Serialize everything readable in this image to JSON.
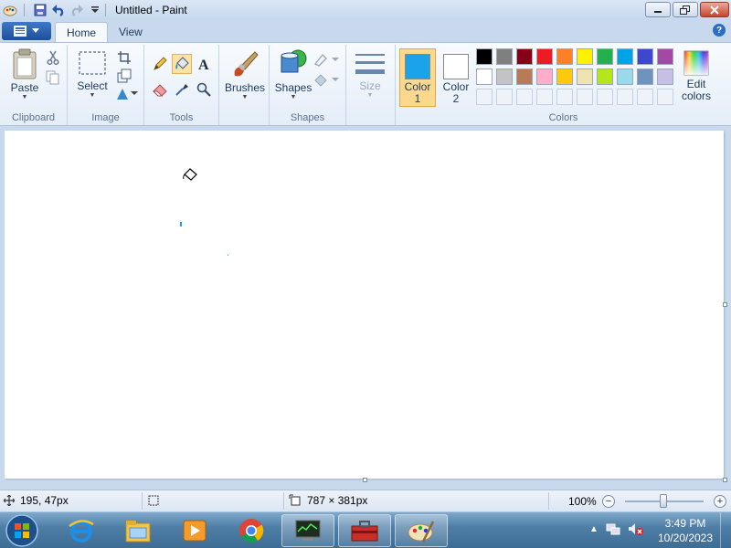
{
  "window": {
    "title": "Untitled - Paint"
  },
  "tabs": {
    "home": "Home",
    "view": "View"
  },
  "ribbon": {
    "clipboard": {
      "group_label": "Clipboard",
      "paste_label": "Paste"
    },
    "image": {
      "group_label": "Image",
      "select_label": "Select"
    },
    "tools": {
      "group_label": "Tools"
    },
    "brushes": {
      "label": "Brushes"
    },
    "shapes": {
      "group_label": "Shapes",
      "shapes_label": "Shapes"
    },
    "size": {
      "label": "Size"
    },
    "colors": {
      "group_label": "Colors",
      "color1_label": "Color 1",
      "color2_label": "Color 2",
      "color1_value": "#1aa3e8",
      "color2_value": "#ffffff",
      "edit_label": "Edit colors",
      "palette_row1": [
        "#000000",
        "#7f7f7f",
        "#880015",
        "#ed1c24",
        "#ff7f27",
        "#fff200",
        "#22b14c",
        "#00a2e8",
        "#3f48cc",
        "#a349a4"
      ],
      "palette_row2": [
        "#ffffff",
        "#c3c3c3",
        "#b97a57",
        "#ffaec9",
        "#ffc90e",
        "#efe4b0",
        "#b5e61d",
        "#99d9ea",
        "#7092be",
        "#c8bfe7"
      ]
    }
  },
  "canvas": {
    "dot_color": "#1aa3e8"
  },
  "statusbar": {
    "cursor_position": "195, 47px",
    "canvas_size": "787 × 381px",
    "zoom": "100%"
  },
  "taskbar": {
    "clock_time": "3:49 PM",
    "clock_date": "10/20/2023"
  }
}
